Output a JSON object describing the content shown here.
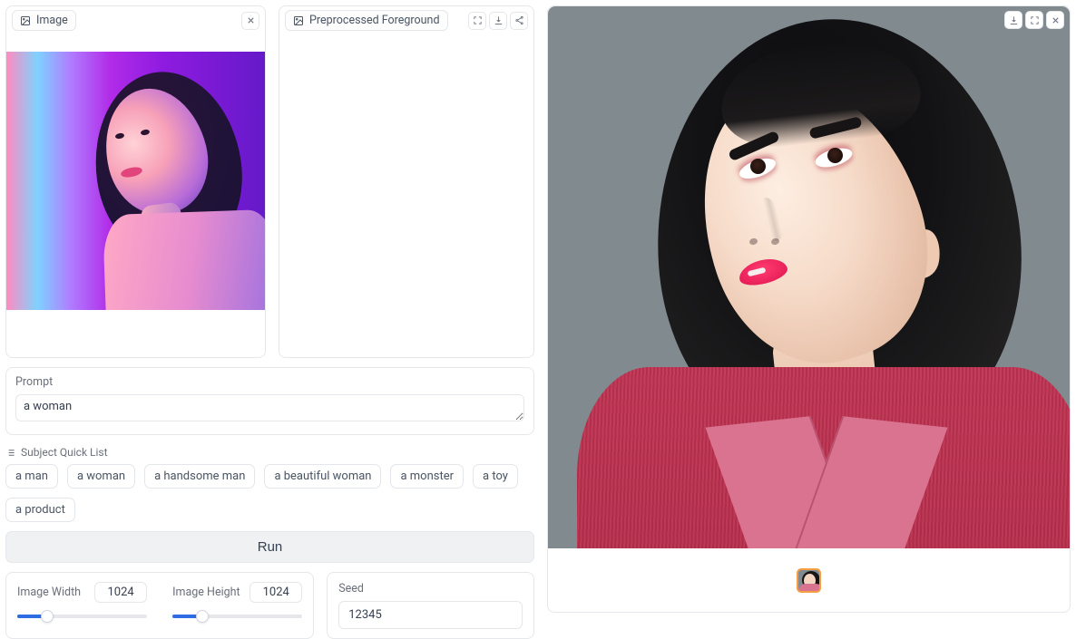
{
  "input_image": {
    "title": "Image"
  },
  "foreground": {
    "title": "Preprocessed Foreground"
  },
  "prompt": {
    "label": "Prompt",
    "value": "a woman"
  },
  "quicklist": {
    "title": "Subject Quick List",
    "items": [
      "a man",
      "a woman",
      "a handsome man",
      "a beautiful woman",
      "a monster",
      "a toy",
      "a product"
    ]
  },
  "run": {
    "label": "Run"
  },
  "image_width": {
    "label": "Image Width",
    "value": "1024"
  },
  "image_height": {
    "label": "Image Height",
    "value": "1024"
  },
  "seed": {
    "label": "Seed",
    "value": "12345"
  },
  "output": {
    "title": ""
  }
}
